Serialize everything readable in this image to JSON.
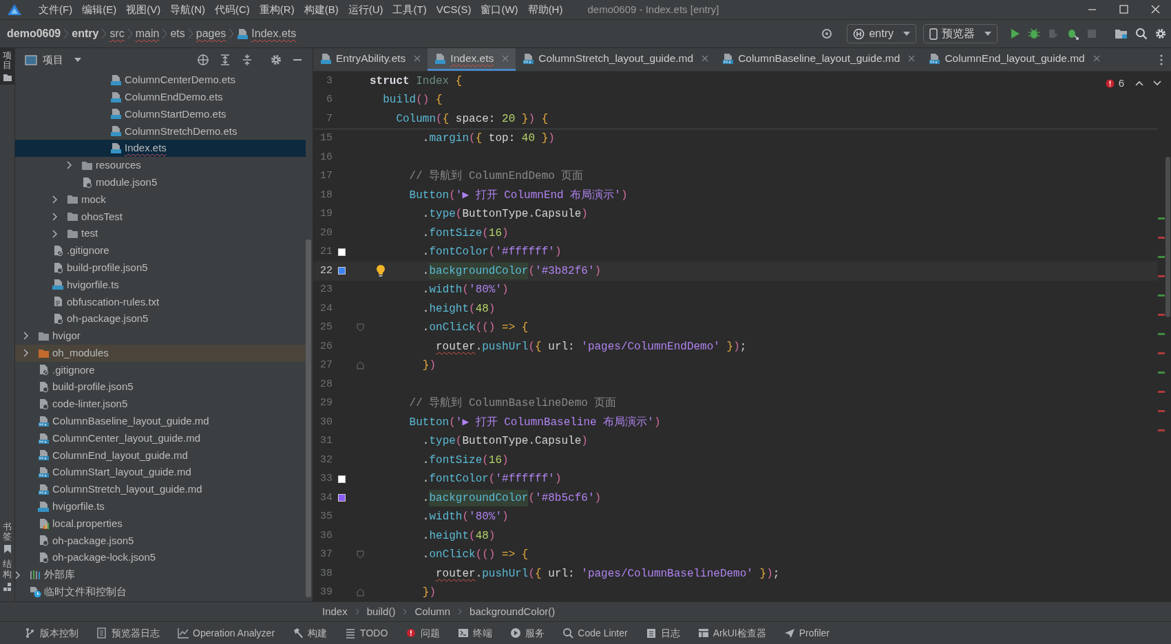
{
  "menu": {
    "items": [
      "文件(F)",
      "编辑(E)",
      "视图(V)",
      "导航(N)",
      "代码(C)",
      "重构(R)",
      "构建(B)",
      "运行(U)",
      "工具(T)",
      "VCS(S)",
      "窗口(W)",
      "帮助(H)"
    ],
    "title": "demo0609 - Index.ets [entry]"
  },
  "breadcrumb": [
    {
      "label": "demo0609",
      "bold": true,
      "error": false
    },
    {
      "label": "entry",
      "bold": true,
      "error": false
    },
    {
      "label": "src",
      "bold": false,
      "error": true
    },
    {
      "label": "main",
      "bold": false,
      "error": true
    },
    {
      "label": "ets",
      "bold": false,
      "error": false
    },
    {
      "label": "pages",
      "bold": false,
      "error": true
    },
    {
      "label": "Index.ets",
      "bold": false,
      "error": true,
      "kind": "ets"
    }
  ],
  "toolbar": {
    "module": "entry",
    "device": "预览器"
  },
  "side_strip": [
    {
      "label": "项目",
      "selected": true
    },
    {
      "label": "书签",
      "selected": false
    },
    {
      "label": "结构",
      "selected": false
    }
  ],
  "project_panel": {
    "title": "项目",
    "tree": [
      {
        "children": [
          {
            "children": [
              {
                "children": [
                  {
                    "children": [
                      {
                        "children": [
                          {
                            "children": [
                              {
                                "label": "ColumnCenterDemo.ets",
                                "kind": "ets",
                                "selected": false,
                                "error": false
                              },
                              {
                                "label": "ColumnEndDemo.ets",
                                "kind": "ets",
                                "selected": false,
                                "error": false
                              },
                              {
                                "label": "ColumnStartDemo.ets",
                                "kind": "ets",
                                "selected": false,
                                "error": false
                              },
                              {
                                "label": "ColumnStretchDemo.ets",
                                "kind": "ets",
                                "selected": false,
                                "error": false
                              },
                              {
                                "label": "Index.ets",
                                "kind": "ets",
                                "selected": true,
                                "error": true
                              }
                            ]
                          }
                        ]
                      },
                      {
                        "label": "resources",
                        "kind": "folder",
                        "selected": false,
                        "error": false,
                        "expanded": false
                      },
                      {
                        "label": "module.json5",
                        "kind": "json",
                        "selected": false,
                        "error": false
                      }
                    ]
                  },
                  {
                    "label": "mock",
                    "kind": "folder",
                    "selected": false,
                    "error": false,
                    "expanded": false
                  },
                  {
                    "label": "ohosTest",
                    "kind": "folder",
                    "selected": false,
                    "error": false,
                    "expanded": false
                  },
                  {
                    "label": "test",
                    "kind": "folder",
                    "selected": false,
                    "error": false,
                    "expanded": false
                  }
                ]
              },
              {
                "label": ".gitignore",
                "kind": "gitignore",
                "selected": false,
                "error": false
              },
              {
                "label": "build-profile.json5",
                "kind": "json",
                "selected": false,
                "error": false
              },
              {
                "label": "hvigorfile.ts",
                "kind": "ts",
                "selected": false,
                "error": false
              },
              {
                "label": "obfuscation-rules.txt",
                "kind": "txt",
                "selected": false,
                "error": false
              },
              {
                "label": "oh-package.json5",
                "kind": "json",
                "selected": false,
                "error": false
              }
            ]
          },
          {
            "label": "hvigor",
            "kind": "folder",
            "selected": false,
            "error": false,
            "expanded": false
          },
          {
            "label": "oh_modules",
            "kind": "excluded",
            "selected": false,
            "error": false,
            "expanded": false
          },
          {
            "label": ".gitignore",
            "kind": "gitignore",
            "selected": false,
            "error": false
          },
          {
            "label": "build-profile.json5",
            "kind": "json",
            "selected": false,
            "error": false
          },
          {
            "label": "code-linter.json5",
            "kind": "json",
            "selected": false,
            "error": false
          },
          {
            "label": "ColumnBaseline_layout_guide.md",
            "kind": "md",
            "selected": false,
            "error": false
          },
          {
            "label": "ColumnCenter_layout_guide.md",
            "kind": "md",
            "selected": false,
            "error": false
          },
          {
            "label": "ColumnEnd_layout_guide.md",
            "kind": "md",
            "selected": false,
            "error": false
          },
          {
            "label": "ColumnStart_layout_guide.md",
            "kind": "md",
            "selected": false,
            "error": false
          },
          {
            "label": "ColumnStretch_layout_guide.md",
            "kind": "md",
            "selected": false,
            "error": false
          },
          {
            "label": "hvigorfile.ts",
            "kind": "ts",
            "selected": false,
            "error": false
          },
          {
            "label": "local.properties",
            "kind": "properties",
            "selected": false,
            "error": false
          },
          {
            "label": "oh-package.json5",
            "kind": "json",
            "selected": false,
            "error": false
          },
          {
            "label": "oh-package-lock.json5",
            "kind": "json",
            "selected": false,
            "error": false
          }
        ]
      },
      {
        "label": "外部库",
        "kind": "library",
        "selected": false,
        "error": false,
        "expanded": false
      },
      {
        "label": "临时文件和控制台",
        "kind": "scratch",
        "selected": false,
        "error": false
      }
    ]
  },
  "tabs": [
    {
      "label": "EntryAbility.ets",
      "kind": "ets",
      "selected": false,
      "error": false
    },
    {
      "label": "Index.ets",
      "kind": "ets",
      "selected": true,
      "error": true
    },
    {
      "label": "ColumnStretch_layout_guide.md",
      "kind": "md",
      "selected": false,
      "error": false
    },
    {
      "label": "ColumnBaseline_layout_guide.md",
      "kind": "md",
      "selected": false,
      "error": false
    },
    {
      "label": "ColumnEnd_layout_guide.md",
      "kind": "md",
      "selected": false,
      "error": false
    }
  ],
  "editor": {
    "problems": "6",
    "sticky_lines": [
      {
        "number": "3",
        "tokens": [
          {
            "kind": "kw",
            "text": "struct"
          },
          {
            "kind": "cls",
            "text": " Index"
          },
          {
            "kind": "br",
            "text": " {"
          }
        ]
      },
      {
        "number": "6",
        "tokens": [
          {
            "kind": "fn",
            "text": "  build"
          },
          {
            "kind": "par",
            "text": "()"
          },
          {
            "kind": "br",
            "text": " {"
          }
        ]
      },
      {
        "number": "7",
        "tokens": [
          {
            "kind": "fn",
            "text": "    Column"
          },
          {
            "kind": "par",
            "text": "("
          },
          {
            "kind": "br",
            "text": "{"
          },
          {
            "kind": "plain",
            "text": " space: "
          },
          {
            "kind": "num",
            "text": "20"
          },
          {
            "kind": "br",
            "text": " }"
          },
          {
            "kind": "par",
            "text": ")"
          },
          {
            "kind": "br",
            "text": " {"
          }
        ]
      }
    ],
    "lines": [
      {
        "number": "15",
        "current": false,
        "tokens": [
          {
            "kind": "plain",
            "text": "        ."
          },
          {
            "kind": "fn",
            "text": "margin"
          },
          {
            "kind": "par",
            "text": "("
          },
          {
            "kind": "br",
            "text": "{"
          },
          {
            "kind": "plain",
            "text": " top: "
          },
          {
            "kind": "num",
            "text": "40"
          },
          {
            "kind": "br",
            "text": " }"
          },
          {
            "kind": "par",
            "text": ")"
          }
        ]
      },
      {
        "number": "16",
        "current": false
      },
      {
        "number": "17",
        "current": false,
        "tokens": [
          {
            "kind": "cmt",
            "text": "      // 导航到 ColumnEndDemo 页面"
          }
        ]
      },
      {
        "number": "18",
        "current": false,
        "tokens": [
          {
            "kind": "fn",
            "text": "      Button"
          },
          {
            "kind": "par",
            "text": "("
          },
          {
            "kind": "str",
            "text": "'▶ 打开 ColumnEnd 布局演示'"
          },
          {
            "kind": "par",
            "text": ")"
          }
        ]
      },
      {
        "number": "19",
        "current": false,
        "tokens": [
          {
            "kind": "plain",
            "text": "        ."
          },
          {
            "kind": "fn",
            "text": "type"
          },
          {
            "kind": "par",
            "text": "("
          },
          {
            "kind": "plain",
            "text": "ButtonType.Capsule"
          },
          {
            "kind": "par",
            "text": ")"
          }
        ]
      },
      {
        "number": "20",
        "current": false,
        "tokens": [
          {
            "kind": "plain",
            "text": "        ."
          },
          {
            "kind": "fn",
            "text": "fontSize"
          },
          {
            "kind": "par",
            "text": "("
          },
          {
            "kind": "num",
            "text": "16"
          },
          {
            "kind": "par",
            "text": ")"
          }
        ]
      },
      {
        "number": "21",
        "current": false,
        "gutter": [
          {
            "kind": "swatch",
            "color": "#ffffff"
          }
        ],
        "tokens": [
          {
            "kind": "plain",
            "text": "        ."
          },
          {
            "kind": "fn",
            "text": "fontColor"
          },
          {
            "kind": "par",
            "text": "("
          },
          {
            "kind": "str",
            "text": "'#ffffff'"
          },
          {
            "kind": "par",
            "text": ")"
          }
        ]
      },
      {
        "number": "22",
        "current": true,
        "gutter": [
          {
            "kind": "swatch",
            "color": "#3b82f6"
          },
          {
            "kind": "bulb"
          }
        ],
        "tokens": [
          {
            "kind": "plain",
            "text": "        ."
          },
          {
            "kind": "hl",
            "text": "backgroundColor"
          },
          {
            "kind": "par",
            "text": "("
          },
          {
            "kind": "str",
            "text": "'#3b82f6'"
          },
          {
            "kind": "par",
            "text": ")"
          }
        ]
      },
      {
        "number": "23",
        "current": false,
        "tokens": [
          {
            "kind": "plain",
            "text": "        ."
          },
          {
            "kind": "fn",
            "text": "width"
          },
          {
            "kind": "par",
            "text": "("
          },
          {
            "kind": "str",
            "text": "'80%'"
          },
          {
            "kind": "par",
            "text": ")"
          }
        ]
      },
      {
        "number": "24",
        "current": false,
        "tokens": [
          {
            "kind": "plain",
            "text": "        ."
          },
          {
            "kind": "fn",
            "text": "height"
          },
          {
            "kind": "par",
            "text": "("
          },
          {
            "kind": "num",
            "text": "48"
          },
          {
            "kind": "par",
            "text": ")"
          }
        ]
      },
      {
        "number": "25",
        "current": false,
        "gutter": [
          {
            "kind": "fold-start"
          }
        ],
        "tokens": [
          {
            "kind": "plain",
            "text": "        ."
          },
          {
            "kind": "fn",
            "text": "onClick"
          },
          {
            "kind": "par",
            "text": "(()"
          },
          {
            "kind": "br",
            "text": " => {"
          }
        ]
      },
      {
        "number": "26",
        "current": false,
        "tokens": [
          {
            "kind": "err",
            "text": "          router"
          },
          {
            "kind": "plain",
            "text": "."
          },
          {
            "kind": "fn",
            "text": "pushUrl"
          },
          {
            "kind": "par",
            "text": "("
          },
          {
            "kind": "br",
            "text": "{"
          },
          {
            "kind": "plain",
            "text": " url: "
          },
          {
            "kind": "str",
            "text": "'pages/ColumnEndDemo'"
          },
          {
            "kind": "br",
            "text": " }"
          },
          {
            "kind": "par",
            "text": ")"
          },
          {
            "kind": "plain",
            "text": ";"
          }
        ]
      },
      {
        "number": "27",
        "current": false,
        "gutter": [
          {
            "kind": "fold-end"
          }
        ],
        "tokens": [
          {
            "kind": "br",
            "text": "        }"
          },
          {
            "kind": "par",
            "text": ")"
          }
        ]
      },
      {
        "number": "28",
        "current": false
      },
      {
        "number": "29",
        "current": false,
        "tokens": [
          {
            "kind": "cmt",
            "text": "      // 导航到 ColumnBaselineDemo 页面"
          }
        ]
      },
      {
        "number": "30",
        "current": false,
        "tokens": [
          {
            "kind": "fn",
            "text": "      Button"
          },
          {
            "kind": "par",
            "text": "("
          },
          {
            "kind": "str",
            "text": "'▶ 打开 ColumnBaseline 布局演示'"
          },
          {
            "kind": "par",
            "text": ")"
          }
        ]
      },
      {
        "number": "31",
        "current": false,
        "tokens": [
          {
            "kind": "plain",
            "text": "        ."
          },
          {
            "kind": "fn",
            "text": "type"
          },
          {
            "kind": "par",
            "text": "("
          },
          {
            "kind": "plain",
            "text": "ButtonType.Capsule"
          },
          {
            "kind": "par",
            "text": ")"
          }
        ]
      },
      {
        "number": "32",
        "current": false,
        "tokens": [
          {
            "kind": "plain",
            "text": "        ."
          },
          {
            "kind": "fn",
            "text": "fontSize"
          },
          {
            "kind": "par",
            "text": "("
          },
          {
            "kind": "num",
            "text": "16"
          },
          {
            "kind": "par",
            "text": ")"
          }
        ]
      },
      {
        "number": "33",
        "current": false,
        "gutter": [
          {
            "kind": "swatch",
            "color": "#ffffff"
          }
        ],
        "tokens": [
          {
            "kind": "plain",
            "text": "        ."
          },
          {
            "kind": "fn",
            "text": "fontColor"
          },
          {
            "kind": "par",
            "text": "("
          },
          {
            "kind": "str",
            "text": "'#ffffff'"
          },
          {
            "kind": "par",
            "text": ")"
          }
        ]
      },
      {
        "number": "34",
        "current": false,
        "gutter": [
          {
            "kind": "swatch",
            "color": "#8b5cf6"
          }
        ],
        "tokens": [
          {
            "kind": "plain",
            "text": "        ."
          },
          {
            "kind": "hl",
            "text": "backgroundColor"
          },
          {
            "kind": "par",
            "text": "("
          },
          {
            "kind": "str",
            "text": "'#8b5cf6'"
          },
          {
            "kind": "par",
            "text": ")"
          }
        ]
      },
      {
        "number": "35",
        "current": false,
        "tokens": [
          {
            "kind": "plain",
            "text": "        ."
          },
          {
            "kind": "fn",
            "text": "width"
          },
          {
            "kind": "par",
            "text": "("
          },
          {
            "kind": "str",
            "text": "'80%'"
          },
          {
            "kind": "par",
            "text": ")"
          }
        ]
      },
      {
        "number": "36",
        "current": false,
        "tokens": [
          {
            "kind": "plain",
            "text": "        ."
          },
          {
            "kind": "fn",
            "text": "height"
          },
          {
            "kind": "par",
            "text": "("
          },
          {
            "kind": "num",
            "text": "48"
          },
          {
            "kind": "par",
            "text": ")"
          }
        ]
      },
      {
        "number": "37",
        "current": false,
        "gutter": [
          {
            "kind": "fold-start"
          }
        ],
        "tokens": [
          {
            "kind": "plain",
            "text": "        ."
          },
          {
            "kind": "fn",
            "text": "onClick"
          },
          {
            "kind": "par",
            "text": "(()"
          },
          {
            "kind": "br",
            "text": " => {"
          }
        ]
      },
      {
        "number": "38",
        "current": false,
        "tokens": [
          {
            "kind": "err",
            "text": "          router"
          },
          {
            "kind": "plain",
            "text": "."
          },
          {
            "kind": "fn",
            "text": "pushUrl"
          },
          {
            "kind": "par",
            "text": "("
          },
          {
            "kind": "br",
            "text": "{"
          },
          {
            "kind": "plain",
            "text": " url: "
          },
          {
            "kind": "str",
            "text": "'pages/ColumnBaselineDemo'"
          },
          {
            "kind": "br",
            "text": " }"
          },
          {
            "kind": "par",
            "text": ")"
          },
          {
            "kind": "plain",
            "text": ";"
          }
        ]
      },
      {
        "number": "39",
        "current": false,
        "gutter": [
          {
            "kind": "fold-end"
          }
        ],
        "tokens": [
          {
            "kind": "br",
            "text": "        }"
          },
          {
            "kind": "par",
            "text": ")"
          }
        ]
      }
    ],
    "stripe_marks": [
      {
        "color": "#3f8f3f"
      },
      {
        "color": "#b03a3a"
      },
      {
        "color": "#3f8f3f"
      },
      {
        "color": "#b03a3a"
      },
      {
        "color": "#3f8f3f"
      },
      {
        "color": "#b03a3a"
      },
      {
        "color": "#3f8f3f"
      },
      {
        "color": "#b03a3a"
      },
      {
        "color": "#3f8f3f"
      },
      {
        "color": "#b03a3a"
      },
      {
        "color": "#b03a3a"
      },
      {
        "color": "#b03a3a"
      }
    ]
  },
  "editor_breadcrumb": [
    "Index",
    "build()",
    "Column",
    "backgroundColor()"
  ],
  "status_bar": [
    {
      "label": "版本控制",
      "kind": "branch"
    },
    {
      "label": "预览器日志",
      "kind": "doc"
    },
    {
      "label": "Operation Analyzer",
      "kind": "chart"
    },
    {
      "label": "构建",
      "kind": "hammer"
    },
    {
      "label": "TODO",
      "kind": "list"
    },
    {
      "label": "问题",
      "kind": "error"
    },
    {
      "label": "终端",
      "kind": "terminal"
    },
    {
      "label": "服务",
      "kind": "play"
    },
    {
      "label": "Code Linter",
      "kind": "linter"
    },
    {
      "label": "日志",
      "kind": "log"
    },
    {
      "label": "ArkUI检查器",
      "kind": "inspector"
    },
    {
      "label": "Profiler",
      "kind": "plane"
    }
  ]
}
